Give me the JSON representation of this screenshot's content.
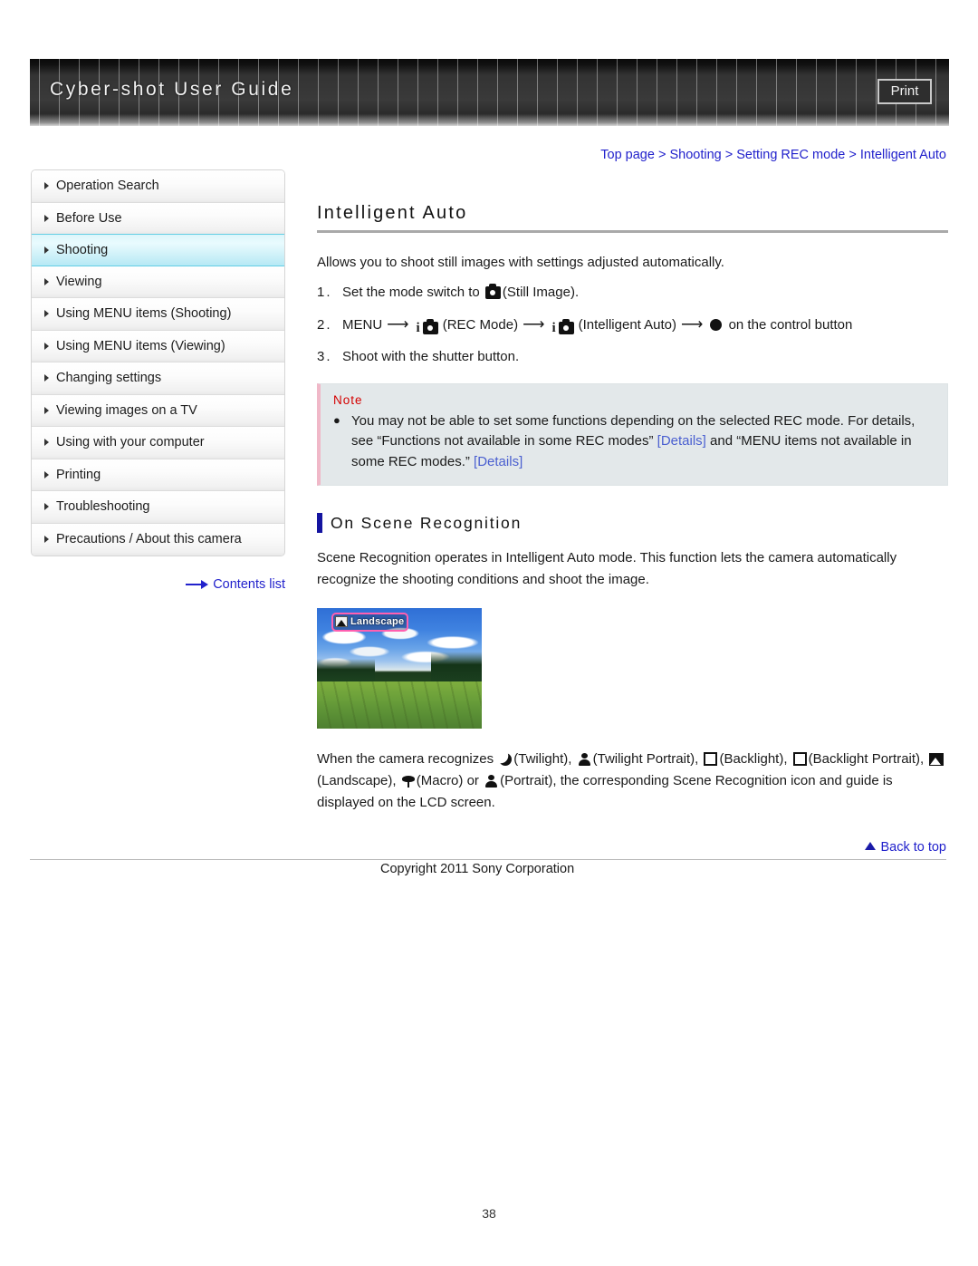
{
  "header": {
    "title": "Cyber-shot User Guide",
    "print_label": "Print"
  },
  "breadcrumb": {
    "items": [
      "Top page",
      "Shooting",
      "Setting REC mode",
      "Intelligent Auto"
    ],
    "separator": ">",
    "full_text": "Top page > Shooting > Setting REC mode > Intelligent Auto"
  },
  "sidebar": {
    "items": [
      {
        "label": "Operation Search",
        "active": false
      },
      {
        "label": "Before Use",
        "active": false
      },
      {
        "label": "Shooting",
        "active": true
      },
      {
        "label": "Viewing",
        "active": false
      },
      {
        "label": "Using MENU items (Shooting)",
        "active": false
      },
      {
        "label": "Using MENU items (Viewing)",
        "active": false
      },
      {
        "label": "Changing settings",
        "active": false
      },
      {
        "label": "Viewing images on a TV",
        "active": false
      },
      {
        "label": "Using with your computer",
        "active": false
      },
      {
        "label": "Printing",
        "active": false
      },
      {
        "label": "Troubleshooting",
        "active": false
      },
      {
        "label": "Precautions / About this camera",
        "active": false
      }
    ],
    "contents_list_label": "Contents list"
  },
  "main": {
    "page_title": "Intelligent Auto",
    "intro": "Allows you to shoot still images with settings adjusted automatically.",
    "steps": [
      {
        "number": "1.",
        "prefix": "Set the mode switch to ",
        "suffix": "(Still Image)."
      },
      {
        "number": "2.",
        "menu_label": "MENU",
        "rec_mode_label": "(REC Mode)",
        "intelligent_auto_label": "(Intelligent Auto)",
        "control_button_label": "on the control button"
      },
      {
        "number": "3.",
        "text": "Shoot with the shutter button."
      }
    ],
    "note": {
      "label": "Note",
      "bullet": "●",
      "part1": "You may not be able to set some functions depending on the selected REC mode. For details, see “Functions not available in some REC modes” ",
      "link1": "[Details]",
      "part2": " and “MENU items not available in some REC modes.” ",
      "link2": "[Details]"
    },
    "subsection": {
      "heading": "On Scene Recognition",
      "paragraph": "Scene Recognition operates in Intelligent Auto mode. This function lets the camera automatically recognize the shooting conditions and shoot the image.",
      "photo_badge_label": "Landscape",
      "closing": {
        "s1": "When the camera recognizes ",
        "s2": "(Twilight), ",
        "s3": "(Twilight Portrait), ",
        "s4": "(Backlight), ",
        "s5": "(Backlight Portrait), ",
        "s6": "(Landscape), ",
        "s7": "(Macro) or ",
        "s8": "(Portrait), the corresponding Scene Recognition icon and guide is displayed on the LCD screen."
      }
    }
  },
  "footer": {
    "back_to_top": "Back to top",
    "copyright": "Copyright 2011 Sony Corporation",
    "page_number": "38"
  },
  "colors": {
    "link_blue": "#2222cc",
    "note_red": "#d40000",
    "subhead_bar_blue": "#1414a0",
    "active_item_cyan": "#63cee4",
    "badge_pink": "#ff5fb0"
  }
}
